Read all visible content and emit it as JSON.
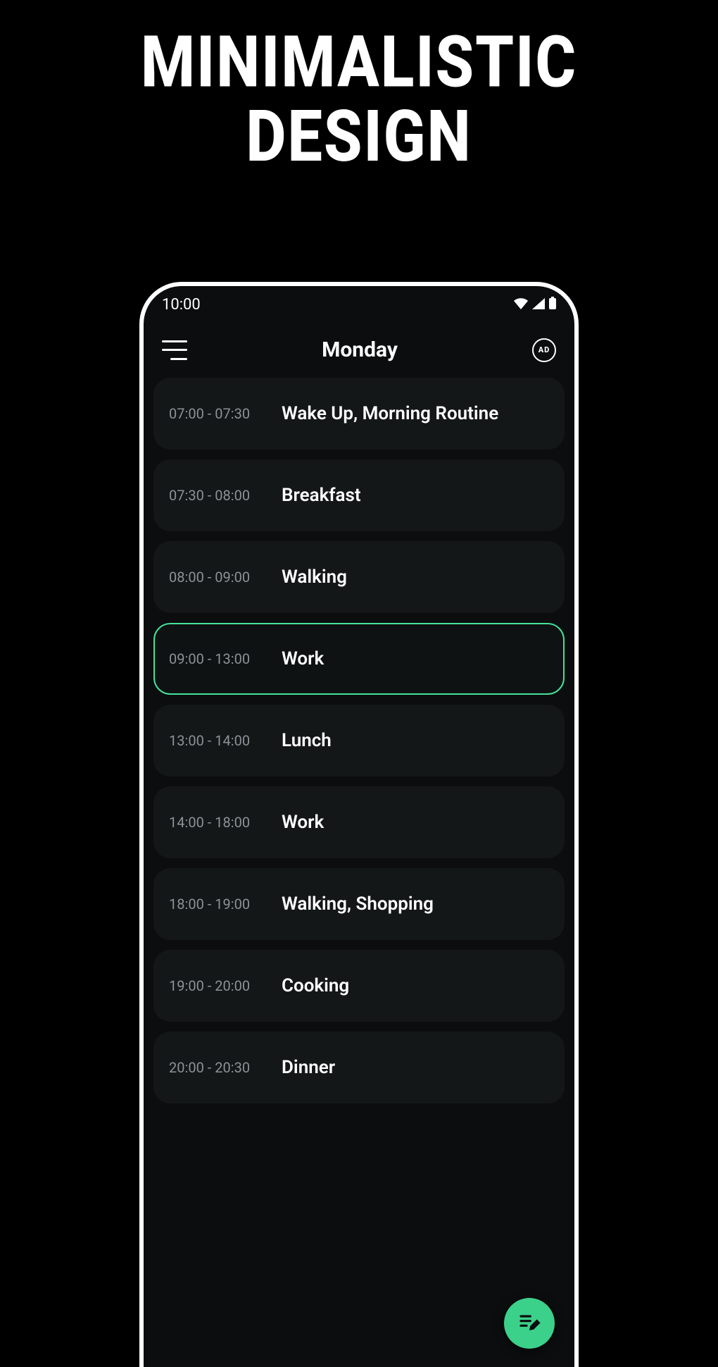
{
  "promo": {
    "line1": "MINIMALISTIC",
    "line2": "DESIGN"
  },
  "statusbar": {
    "time": "10:00"
  },
  "topbar": {
    "title": "Monday",
    "ad_label": "AD"
  },
  "colors": {
    "accent": "#3bd18a",
    "active_border": "#45e29a"
  },
  "schedule": [
    {
      "time": "07:00 - 07:30",
      "label": "Wake Up, Morning Routine",
      "active": false
    },
    {
      "time": "07:30 - 08:00",
      "label": "Breakfast",
      "active": false
    },
    {
      "time": "08:00 - 09:00",
      "label": "Walking",
      "active": false
    },
    {
      "time": "09:00 - 13:00",
      "label": "Work",
      "active": true
    },
    {
      "time": "13:00 - 14:00",
      "label": "Lunch",
      "active": false
    },
    {
      "time": "14:00 - 18:00",
      "label": "Work",
      "active": false
    },
    {
      "time": "18:00 - 19:00",
      "label": "Walking, Shopping",
      "active": false
    },
    {
      "time": "19:00 - 20:00",
      "label": "Cooking",
      "active": false
    },
    {
      "time": "20:00 - 20:30",
      "label": "Dinner",
      "active": false
    }
  ]
}
